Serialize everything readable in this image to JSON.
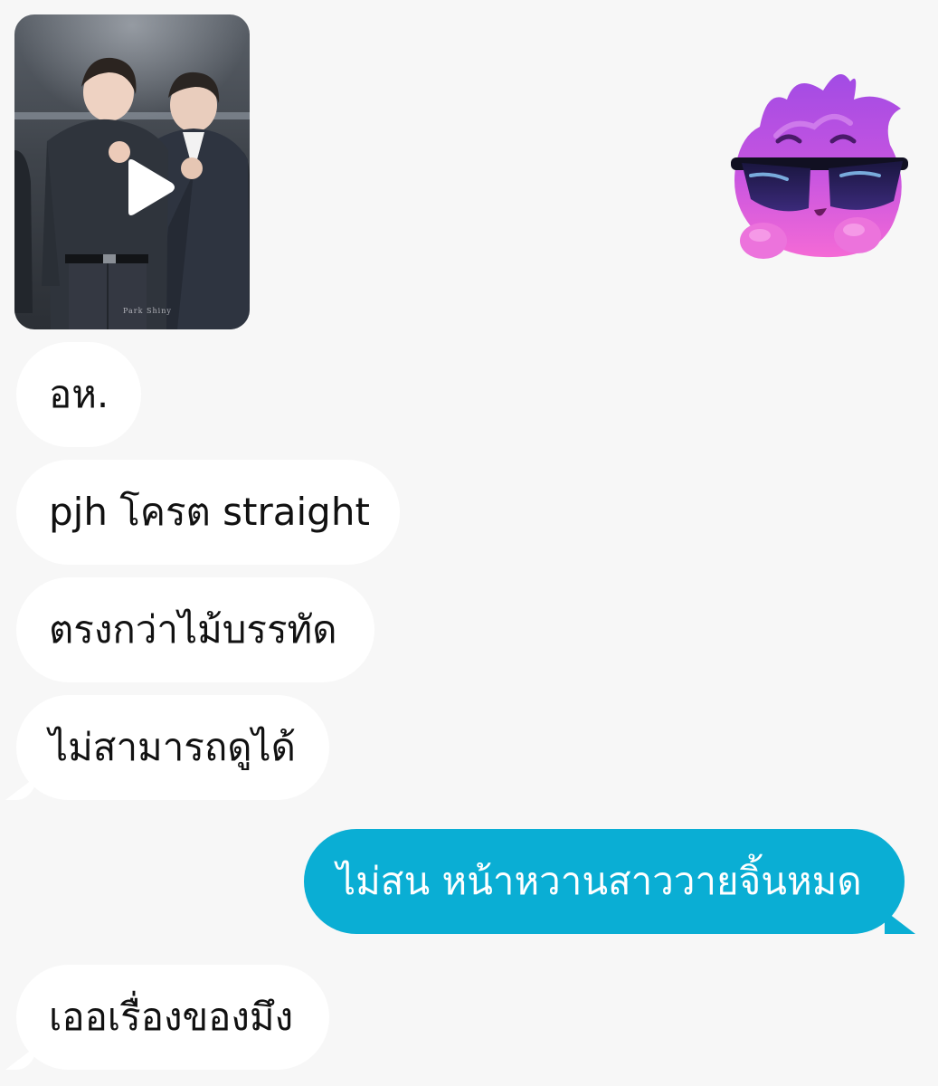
{
  "chat": {
    "video": {
      "watermark": "Park Shiny",
      "icon": "play-icon"
    },
    "sticker": {
      "icon": "purple-flame-sunglasses-sticker"
    },
    "messages": [
      {
        "direction": "incoming",
        "text": "อห."
      },
      {
        "direction": "incoming",
        "text": "pjh โครต straight"
      },
      {
        "direction": "incoming",
        "text": "ตรงกว่าไม้บรรทัด"
      },
      {
        "direction": "incoming",
        "text": "ไม่สามารถดูได้"
      },
      {
        "direction": "outgoing",
        "text": "ไม่สน หน้าหวานสาววายจิ้นหมด"
      },
      {
        "direction": "incoming",
        "text": "เออเรื่องของมึง"
      }
    ]
  },
  "colors": {
    "background": "#f7f7f7",
    "incoming_bubble": "#ffffff",
    "outgoing_bubble": "#0aaed4",
    "sticker_purple": "#b44ee0",
    "sticker_pink": "#f06ad8"
  }
}
